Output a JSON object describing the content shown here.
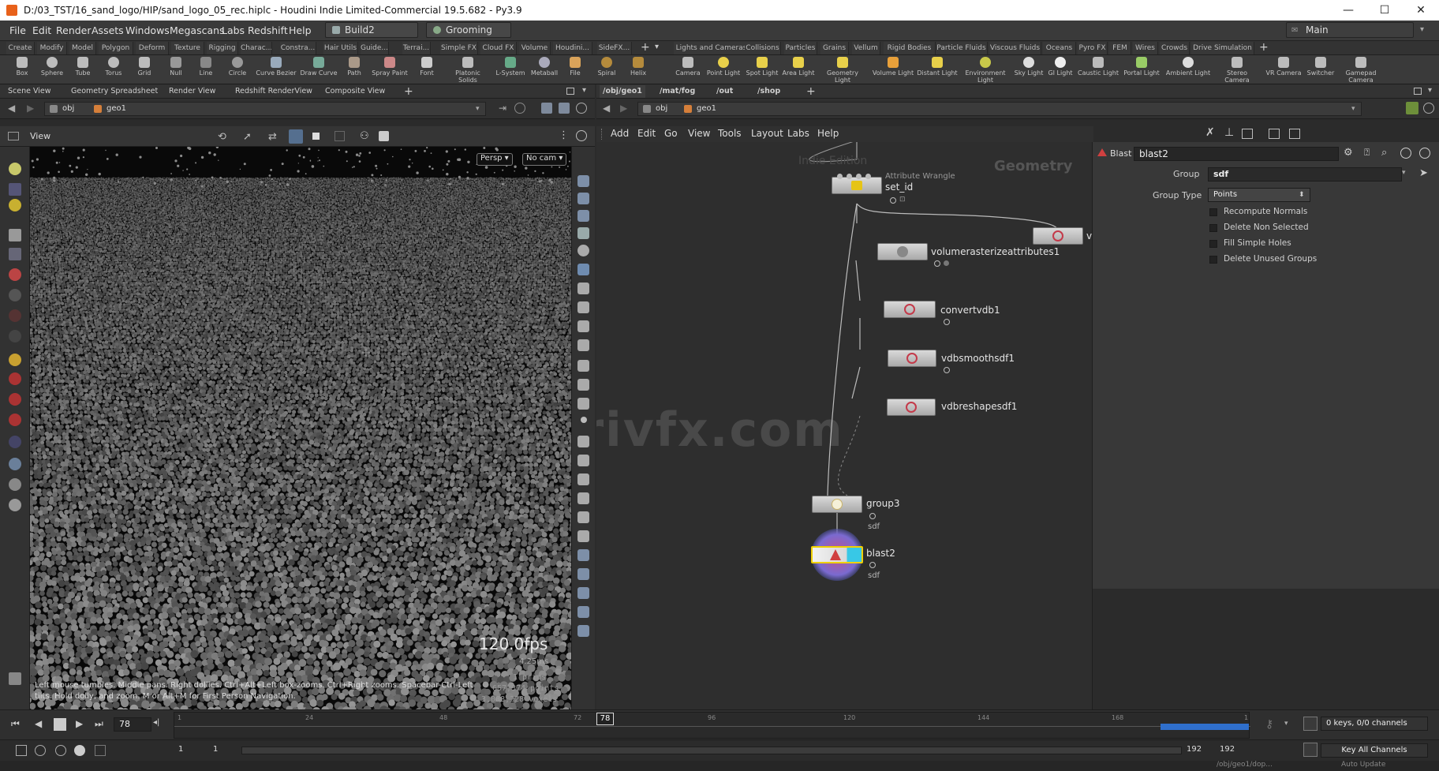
{
  "window": {
    "title": "D:/03_TST/16_sand_logo/HIP/sand_logo_05_rec.hiplc - Houdini Indie Limited-Commercial 19.5.682 - Py3.9",
    "controls": [
      "—",
      "☐",
      "✕"
    ]
  },
  "menubar": {
    "items": [
      "File",
      "Edit",
      "Render",
      "Assets",
      "Windows",
      "Megascans",
      "Labs",
      "Redshift",
      "Help"
    ],
    "desktop": "Build2",
    "context": "Grooming",
    "workspace": "Main"
  },
  "shelf_tabs_left": [
    "Create",
    "Modify",
    "Model",
    "Polygon",
    "Deform",
    "Texture",
    "Rigging",
    "Charac...",
    "Constra...",
    "Hair Utils",
    "Guide...",
    "Terrai...",
    "Simple FX",
    "Cloud FX",
    "Volume",
    "Houdini...",
    "SideFX..."
  ],
  "shelf_tabs_right": [
    "Lights and Cameras",
    "Collisions",
    "Particles",
    "Grains",
    "Vellum",
    "Rigid Bodies",
    "Particle Fluids",
    "Viscous Fluids",
    "Oceans",
    "Pyro FX",
    "FEM",
    "Wires",
    "Crowds",
    "Drive Simulation"
  ],
  "shelf_tools_left": [
    "Box",
    "Sphere",
    "Tube",
    "Torus",
    "Grid",
    "Null",
    "Line",
    "Circle",
    "Curve Bezier",
    "Draw Curve",
    "Path",
    "Spray Paint",
    "Font",
    "Platonic Solids",
    "L-System",
    "Metaball",
    "File",
    "Spiral",
    "Helix"
  ],
  "shelf_tools_right": [
    "Camera",
    "Point Light",
    "Spot Light",
    "Area Light",
    "Geometry Light",
    "Volume Light",
    "Distant Light",
    "Environment Light",
    "Sky Light",
    "GI Light",
    "Caustic Light",
    "Portal Light",
    "Ambient Light",
    "Stereo Camera",
    "VR Camera",
    "Switcher",
    "Gamepad Camera"
  ],
  "left_pane": {
    "tabs": [
      "Scene View",
      "Geometry Spreadsheet",
      "Render View",
      "Redshift RenderView",
      "Composite View"
    ],
    "path": [
      "obj",
      "geo1"
    ],
    "view_label": "View",
    "persp": "Persp",
    "cam": "No cam",
    "fps": "120.0fps",
    "ms": "4.25ms",
    "stats": [
      "1  prims",
      "657,374 points",
      "3,088,228 voxels"
    ],
    "hint": "Left mouse tumbles. Middle pans. Right dollies. Ctrl+Alt+Left box-zooms. Ctrl+Right zooms. Spacebar-Ctrl-Left tilts. Hold dolly, and zoom.     M or Alt+M for First Person Navigation."
  },
  "right_pane": {
    "tabs": [
      "/obj/geo1",
      "/mat/fog",
      "/out",
      "/shop"
    ],
    "path": [
      "obj",
      "geo1"
    ],
    "menu": [
      "Add",
      "Edit",
      "Go",
      "View",
      "Tools",
      "Layout",
      "Labs",
      "Help"
    ],
    "watermark_edition": "Indie Edition",
    "watermark_context": "Geometry",
    "overlay": "rrivfx.com",
    "nodes": {
      "wrangle_type": "Attribute Wrangle",
      "set_id": "set_id",
      "volume": "volumerasterizeattributes1",
      "convert": "convertvdb1",
      "smooth": "vdbsmoothsdf1",
      "reshape": "vdbreshapesdf1",
      "group3": "group3",
      "group3_flag": "sdf",
      "blast2": "blast2",
      "blast2_flag": "sdf",
      "partial": "v"
    }
  },
  "params": {
    "type": "Blast",
    "name": "blast2",
    "group_label": "Group",
    "group_value": "sdf",
    "group_type_label": "Group Type",
    "group_type_value": "Points",
    "toggles": [
      "Recompute Normals",
      "Delete Non Selected",
      "Fill Simple Holes",
      "Delete Unused Groups"
    ]
  },
  "timeline": {
    "frame": "78",
    "ticks": [
      "1",
      "24",
      "48",
      "72",
      "96",
      "120",
      "144",
      "168",
      "1"
    ],
    "keys": "0 keys, 0/0 channels",
    "key_all": "Key All Channels",
    "start": "1",
    "start2": "1",
    "end": "192",
    "end2": "192",
    "status_path": "/obj/geo1/dop...",
    "auto_update": "Auto Update",
    "current_frame_fraction": 0.4
  },
  "colors": {
    "accent_orange": "#e8611a",
    "selected_node": "#f0d000",
    "node_cyan": "#38c8e6",
    "range_blue": "#2f6fcc"
  }
}
